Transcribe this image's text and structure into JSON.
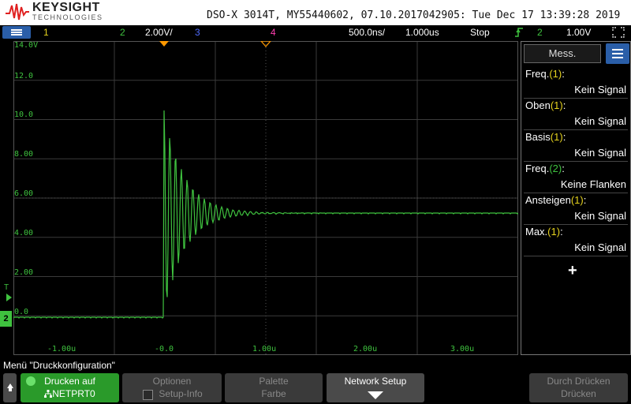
{
  "header": {
    "brand": "KEYSIGHT",
    "brand_sub": "TECHNOLOGIES",
    "title": "DSO-X 3014T, MY55440602, 07.10.2017042905: Tue Dec 17 13:39:28 2019"
  },
  "status_bar": {
    "ch1": "1",
    "ch2": "2",
    "ch2_scale": "2.00V/",
    "ch3": "3",
    "ch4": "4",
    "timebase": "500.0ns/",
    "delay": "1.000us",
    "run_state": "Stop",
    "trigger_channel": "2",
    "trigger_level": "1.00V"
  },
  "grid": {
    "v_labels": [
      "14.0V",
      "12.0",
      "10.0",
      "8.00",
      "6.00",
      "4.00",
      "2.00",
      "0.0"
    ],
    "h_labels": [
      "-1.00u",
      "-0.0",
      "1.00u",
      "2.00u",
      "3.00u"
    ],
    "ground_label": "2"
  },
  "left_markers": {
    "trigger": "T"
  },
  "measurements": {
    "tab_label": "Mess.",
    "items": [
      {
        "name": "Freq.",
        "channel": "(1)",
        "suffix": ":",
        "value": "Kein Signal"
      },
      {
        "name": "Oben",
        "channel": "(1)",
        "suffix": ":",
        "value": "Kein Signal"
      },
      {
        "name": "Basis",
        "channel": "(1)",
        "suffix": ":",
        "value": "Kein Signal"
      },
      {
        "name": "Freq.",
        "channel": "(2)",
        "suffix": ":",
        "value": "Keine Flanken"
      },
      {
        "name": "Ansteigen",
        "channel": "(1)",
        "suffix": ":",
        "value": "Kein Signal"
      },
      {
        "name": "Max.",
        "channel": "(1)",
        "suffix": ":",
        "value": "Kein Signal"
      }
    ],
    "add_symbol": "+"
  },
  "softkeys": {
    "menu_title": "Menü \"Druckkonfiguration\"",
    "print_label": "Drucken auf",
    "print_value": "NETPRT0",
    "print_icon": "network-icon",
    "options_label": "Optionen",
    "options_value": "Setup-Info",
    "palette_label": "Palette",
    "palette_value": "Farbe",
    "network_label": "Network Setup",
    "dd_label": "Durch Drücken",
    "dd_value": "Drücken"
  },
  "colors": {
    "trace": "#3fc23f",
    "grid": "#3a3a3a",
    "menu_blue": "#2a5ea8",
    "ch1": "#e6d31e",
    "ch2": "#3fc23f",
    "ch3": "#4f6cff",
    "ch4": "#ff3fb0",
    "trigger_marker": "#ff9900"
  }
}
